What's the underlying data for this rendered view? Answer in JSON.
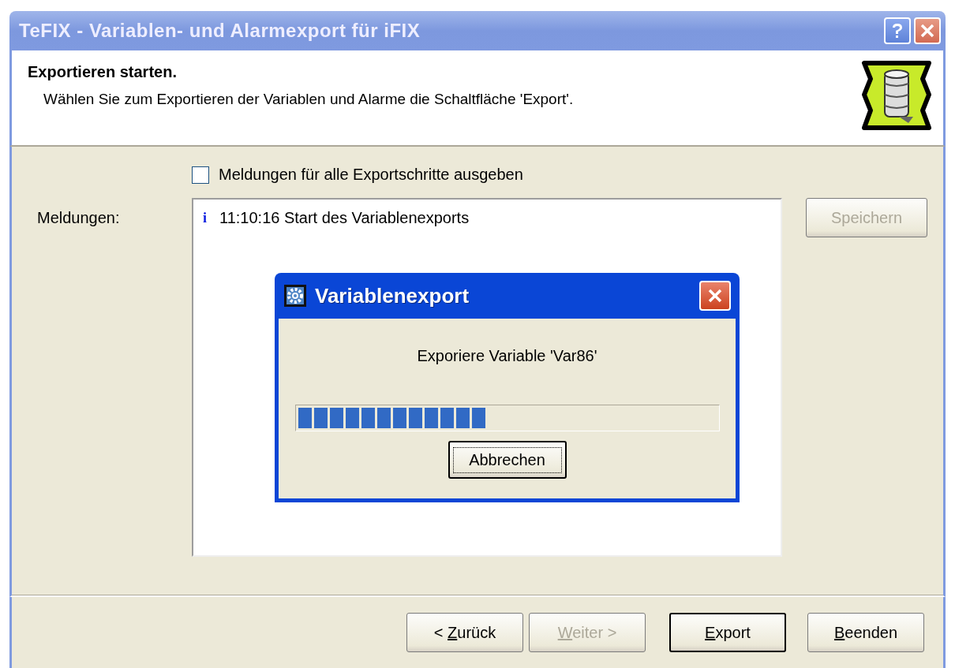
{
  "window": {
    "title": "TeFIX - Variablen- und Alarmexport für iFIX"
  },
  "header": {
    "title": "Exportieren starten.",
    "description": "Wählen Sie zum Exportieren der Variablen und Alarme die Schaltfläche 'Export'."
  },
  "option": {
    "label": "Meldungen für alle Exportschritte ausgeben",
    "checked": false
  },
  "messages": {
    "label": "Meldungen:",
    "entries": [
      {
        "kind": "info",
        "icon": "i",
        "text": "11:10:16 Start des Variablenexports"
      }
    ]
  },
  "save_button": {
    "label": "Speichern",
    "disabled": true
  },
  "buttons": [
    {
      "pre": "< ",
      "key": "Z",
      "post": "urück",
      "disabled": false,
      "default": false
    },
    {
      "key": "W",
      "post": "eiter >",
      "disabled": true,
      "default": false
    },
    {
      "key": "E",
      "post": "xport",
      "disabled": false,
      "default": true
    },
    {
      "key": "B",
      "post": "eenden",
      "disabled": false,
      "default": false
    }
  ],
  "progress_dialog": {
    "title": "Variablenexport",
    "message": "Exporiere Variable 'Var86'",
    "level": 0.45,
    "cancel_button": {
      "label": "Abbrechen",
      "focused": true
    }
  }
}
